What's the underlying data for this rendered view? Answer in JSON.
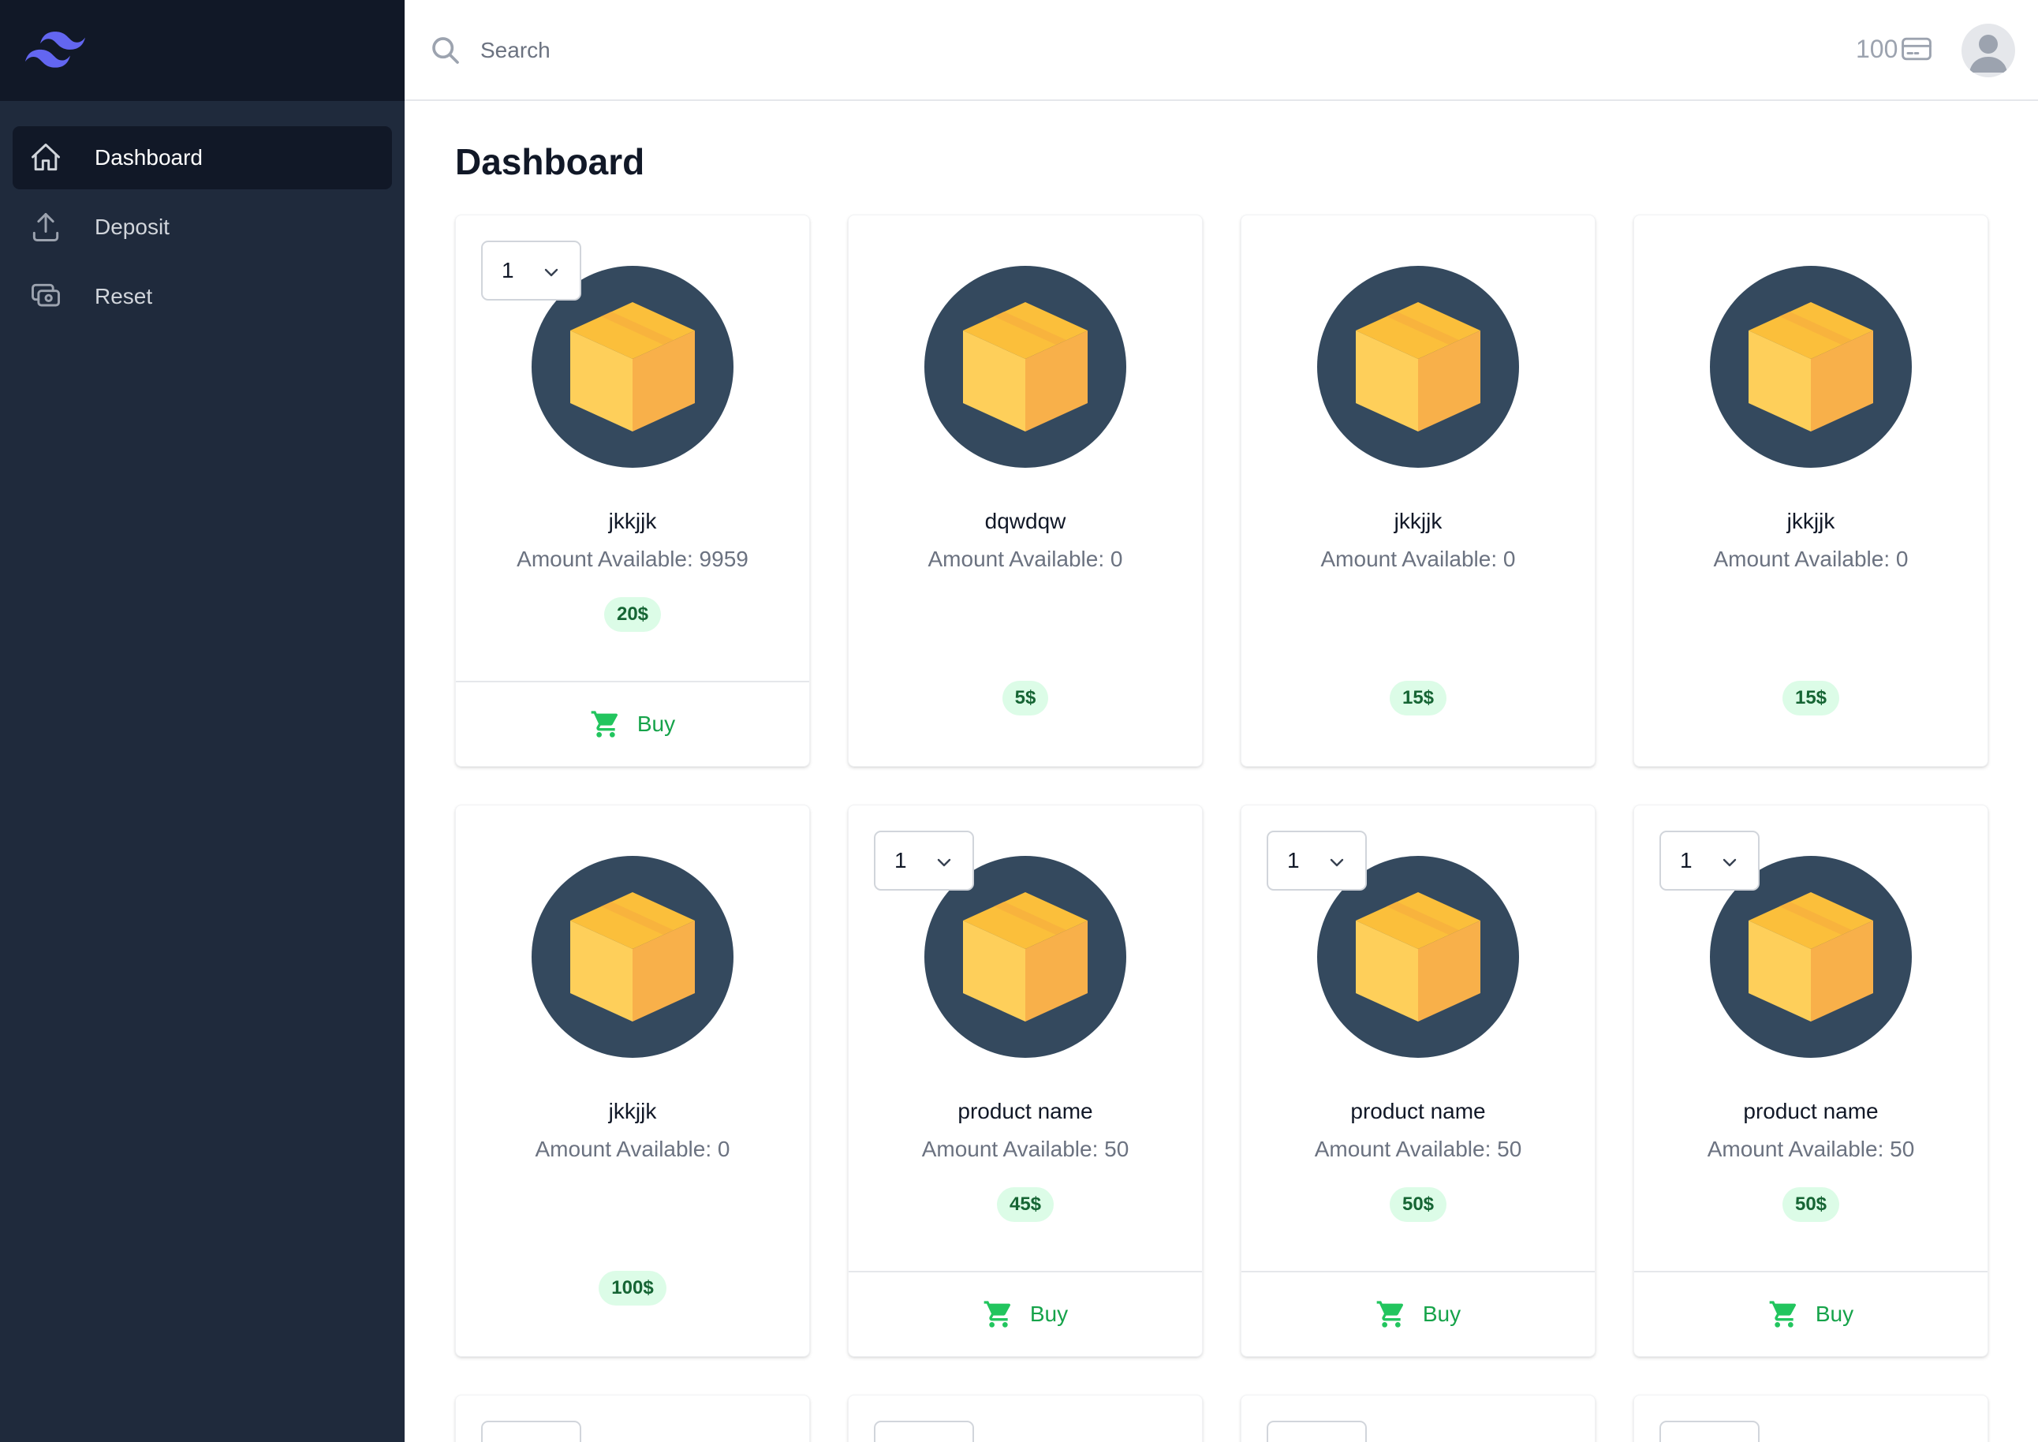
{
  "sidebar": {
    "items": [
      {
        "label": "Dashboard",
        "icon": "home-icon",
        "active": true
      },
      {
        "label": "Deposit",
        "icon": "upload-icon",
        "active": false
      },
      {
        "label": "Reset",
        "icon": "cash-icon",
        "active": false
      }
    ]
  },
  "header": {
    "search_placeholder": "Search",
    "balance": "100",
    "balance_icon": "credit-card-icon"
  },
  "main": {
    "title": "Dashboard",
    "buy_label": "Buy",
    "products": [
      {
        "name": "jkkjjk",
        "amount": "Amount Available: 9959",
        "price": "20$",
        "qty": "1",
        "buyable": true
      },
      {
        "name": "dqwdqw",
        "amount": "Amount Available: 0",
        "price": "5$",
        "qty": "",
        "buyable": false
      },
      {
        "name": "jkkjjk",
        "amount": "Amount Available: 0",
        "price": "15$",
        "qty": "",
        "buyable": false
      },
      {
        "name": "jkkjjk",
        "amount": "Amount Available: 0",
        "price": "15$",
        "qty": "",
        "buyable": false
      },
      {
        "name": "jkkjjk",
        "amount": "Amount Available: 0",
        "price": "100$",
        "qty": "",
        "buyable": false
      },
      {
        "name": "product name",
        "amount": "Amount Available: 50",
        "price": "45$",
        "qty": "1",
        "buyable": true
      },
      {
        "name": "product name",
        "amount": "Amount Available: 50",
        "price": "50$",
        "qty": "1",
        "buyable": true
      },
      {
        "name": "product name",
        "amount": "Amount Available: 50",
        "price": "50$",
        "qty": "1",
        "buyable": true
      }
    ]
  },
  "colors": {
    "sidebar_bg": "#1f2a3c",
    "sidebar_top_bg": "#111827",
    "accent_green": "#16a34a",
    "price_bg": "#dcfce7",
    "logo": "#6366f1",
    "product_circle": "#34495e",
    "box_light": "#fecf5a",
    "box_dark": "#f8b04a"
  }
}
